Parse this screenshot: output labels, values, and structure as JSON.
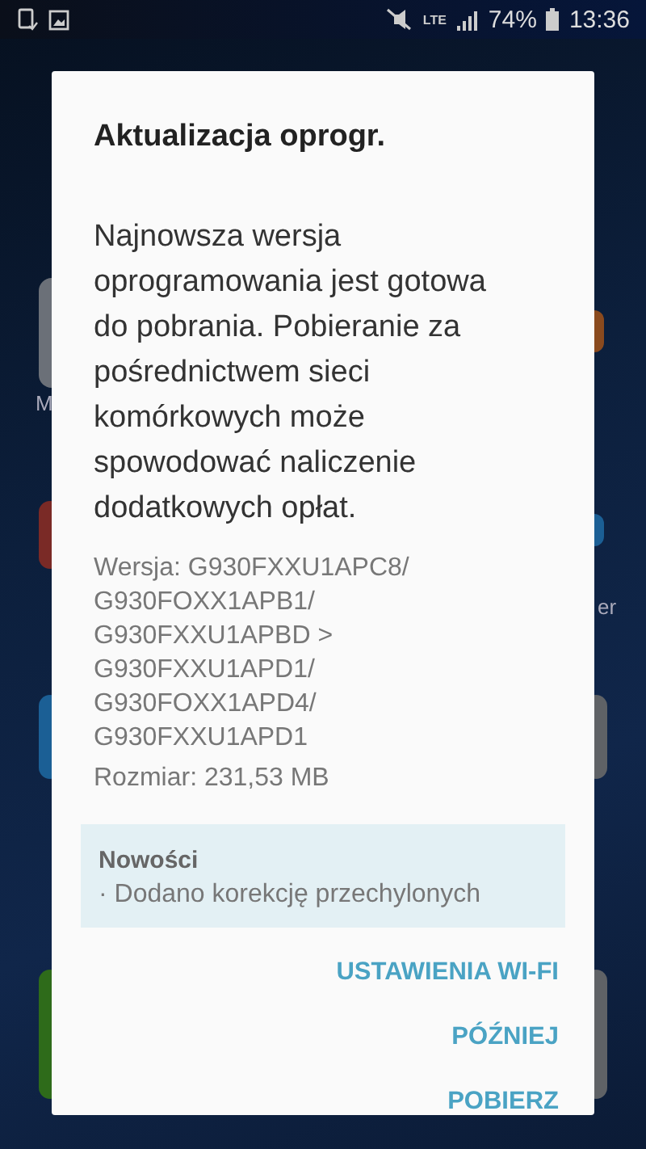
{
  "status_bar": {
    "battery": "74%",
    "time": "13:36",
    "network": "LTE"
  },
  "home_labels": [
    "M",
    "er"
  ],
  "dialog": {
    "title": "Aktualizacja oprogr.",
    "message": "Najnowsza wersja oprogramowania jest gotowa do pobrania. Pobieranie za pośrednictwem sieci komórkowych może spowodować naliczenie dodatkowych opłat.",
    "version_lines": [
      "Wersja: G930FXXU1APC8/",
      "G930FOXX1APB1/",
      "G930FXXU1APBD >",
      "G930FXXU1APD1/",
      "G930FOXX1APD4/",
      "G930FXXU1APD1"
    ],
    "size": "Rozmiar: 231,53 MB",
    "news": {
      "title": "Nowości",
      "items": [
        "· Dodano korekcję przechylonych"
      ]
    },
    "buttons": [
      "USTAWIENIA WI-FI",
      "PÓŹNIEJ",
      "POBIERZ"
    ]
  }
}
